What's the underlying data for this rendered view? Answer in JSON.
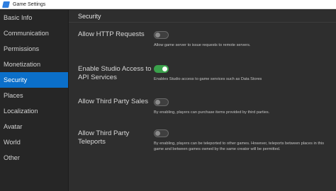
{
  "window": {
    "title": "Game Settings"
  },
  "sidebar": {
    "items": [
      {
        "label": "Basic Info",
        "active": false
      },
      {
        "label": "Communication",
        "active": false
      },
      {
        "label": "Permissions",
        "active": false
      },
      {
        "label": "Monetization",
        "active": false
      },
      {
        "label": "Security",
        "active": true
      },
      {
        "label": "Places",
        "active": false
      },
      {
        "label": "Localization",
        "active": false
      },
      {
        "label": "Avatar",
        "active": false
      },
      {
        "label": "World",
        "active": false
      },
      {
        "label": "Other",
        "active": false
      }
    ]
  },
  "main": {
    "section_title": "Security",
    "settings": [
      {
        "label": "Allow HTTP Requests",
        "enabled": false,
        "description": "Allow game server to issue requests to remote servers."
      },
      {
        "label": "Enable Studio Access to API Services",
        "enabled": true,
        "description": "Enables Studio access to game services such as Data Stores"
      },
      {
        "label": "Allow Third Party Sales",
        "enabled": false,
        "description": "By enabling, players can purchase items provided by third parties."
      },
      {
        "label": "Allow Third Party Teleports",
        "enabled": false,
        "description": "By enabling, players can be teleported to other games. However, teleports between places in this game and between games owned by the same creator will be permitted."
      }
    ]
  },
  "colors": {
    "accent": "#0b6fc9",
    "toggle_on": "#3aa14b",
    "background": "#2e2e2e",
    "sidebar": "#262626"
  }
}
